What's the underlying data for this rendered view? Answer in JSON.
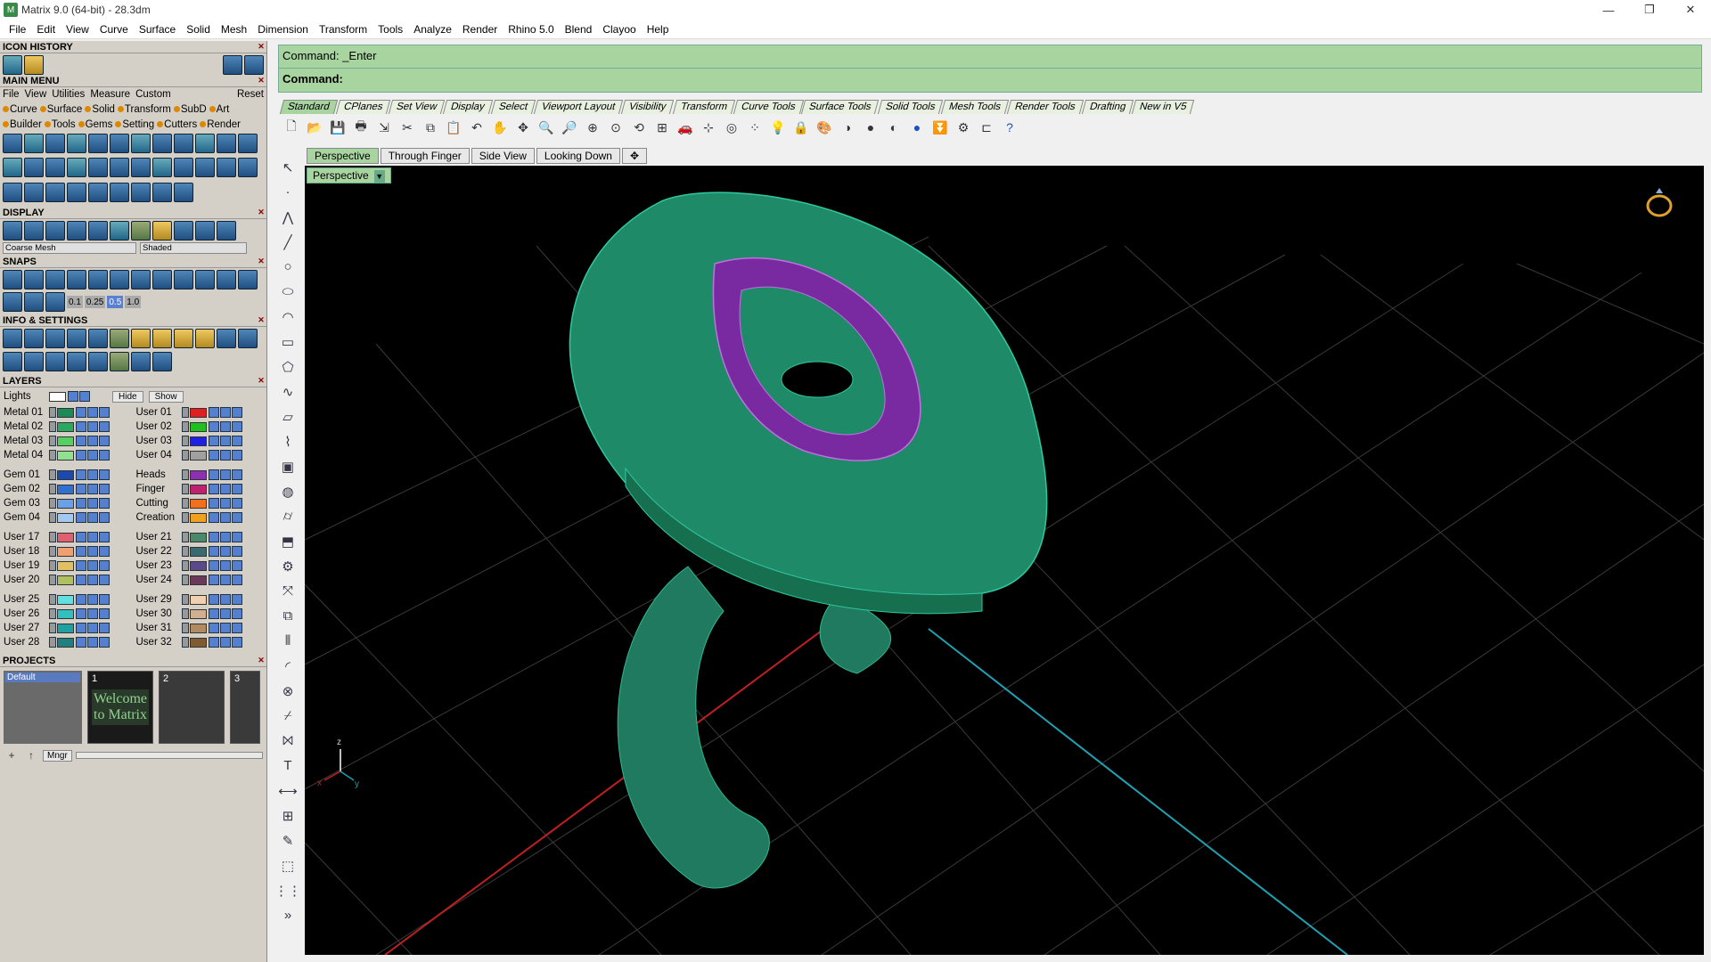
{
  "window": {
    "title": "Matrix 9.0 (64-bit) - 28.3dm",
    "controls": [
      "—",
      "❐",
      "✕"
    ]
  },
  "menu": [
    "File",
    "Edit",
    "View",
    "Curve",
    "Surface",
    "Solid",
    "Mesh",
    "Dimension",
    "Transform",
    "Tools",
    "Analyze",
    "Render",
    "Rhino 5.0",
    "Blend",
    "Clayoo",
    "Help"
  ],
  "left": {
    "icon_history": "ICON HISTORY",
    "main_menu": "MAIN MENU",
    "mm_row1": [
      "File",
      "View",
      "Utilities",
      "Measure",
      "Custom",
      "Reset"
    ],
    "mm_row2": [
      "Curve",
      "Surface",
      "Solid",
      "Transform",
      "SubD",
      "Art"
    ],
    "mm_row3": [
      "Builder",
      "Tools",
      "Gems",
      "Setting",
      "Cutters",
      "Render"
    ],
    "display": "DISPLAY",
    "display_mesh": "Coarse Mesh",
    "display_mode": "Shaded",
    "snaps": "SNAPS",
    "snap_values": [
      "0.1",
      "0.25",
      "0.5",
      "1.0"
    ],
    "info": "INFO & SETTINGS",
    "layers": "LAYERS",
    "lights": "Lights",
    "hide": "Hide",
    "show": "Show",
    "layers_left": [
      {
        "name": "Metal 01",
        "color": "#1e8a5a"
      },
      {
        "name": "Metal 02",
        "color": "#2aa860"
      },
      {
        "name": "Metal 03",
        "color": "#55d060"
      },
      {
        "name": "Metal 04",
        "color": "#90e090"
      },
      {
        "name": "Gem 01",
        "color": "#1a4ab0"
      },
      {
        "name": "Gem 02",
        "color": "#3070d0"
      },
      {
        "name": "Gem 03",
        "color": "#6aa0e8"
      },
      {
        "name": "Gem 04",
        "color": "#a0c8f0"
      },
      {
        "name": "User 17",
        "color": "#e06070"
      },
      {
        "name": "User 18",
        "color": "#f0a070"
      },
      {
        "name": "User 19",
        "color": "#e0c060"
      },
      {
        "name": "User 20",
        "color": "#b0c060"
      },
      {
        "name": "User 25",
        "color": "#60e0e0"
      },
      {
        "name": "User 26",
        "color": "#30c0c0"
      },
      {
        "name": "User 27",
        "color": "#20a0a0"
      },
      {
        "name": "User 28",
        "color": "#208080"
      }
    ],
    "layers_right": [
      {
        "name": "User 01",
        "color": "#e02020"
      },
      {
        "name": "User 02",
        "color": "#20c020"
      },
      {
        "name": "User 03",
        "color": "#2020e0"
      },
      {
        "name": "User 04",
        "color": "#a0a0a0"
      },
      {
        "name": "Heads",
        "color": "#8a30b0"
      },
      {
        "name": "Finger",
        "color": "#c02070"
      },
      {
        "name": "Cutting",
        "color": "#f07020"
      },
      {
        "name": "Creation",
        "color": "#f0a020"
      },
      {
        "name": "User 21",
        "color": "#4a8a6a"
      },
      {
        "name": "User 22",
        "color": "#3a6a70"
      },
      {
        "name": "User 23",
        "color": "#5a4a8a"
      },
      {
        "name": "User 24",
        "color": "#6a3a5a"
      },
      {
        "name": "User 29",
        "color": "#f0d0b0"
      },
      {
        "name": "User 30",
        "color": "#d0b090"
      },
      {
        "name": "User 31",
        "color": "#b08a60"
      },
      {
        "name": "User 32",
        "color": "#805a30"
      }
    ],
    "projects": "PROJECTS",
    "project_default": "Default",
    "thumb_nums": [
      "1",
      "2",
      "3"
    ],
    "welcome": "Welcome to Matrix",
    "mgr": "Mngr"
  },
  "command": {
    "history": "Command: _Enter",
    "prompt": "Command:"
  },
  "toolbar_tabs": [
    "Standard",
    "CPlanes",
    "Set View",
    "Display",
    "Select",
    "Viewport Layout",
    "Visibility",
    "Transform",
    "Curve Tools",
    "Surface Tools",
    "Solid Tools",
    "Mesh Tools",
    "Render Tools",
    "Drafting",
    "New in V5"
  ],
  "viewport_tabs": [
    "Perspective",
    "Through Finger",
    "Side View",
    "Looking Down"
  ],
  "viewport_label": "Perspective",
  "axes": {
    "z": "z",
    "x": "x",
    "y": "y"
  }
}
